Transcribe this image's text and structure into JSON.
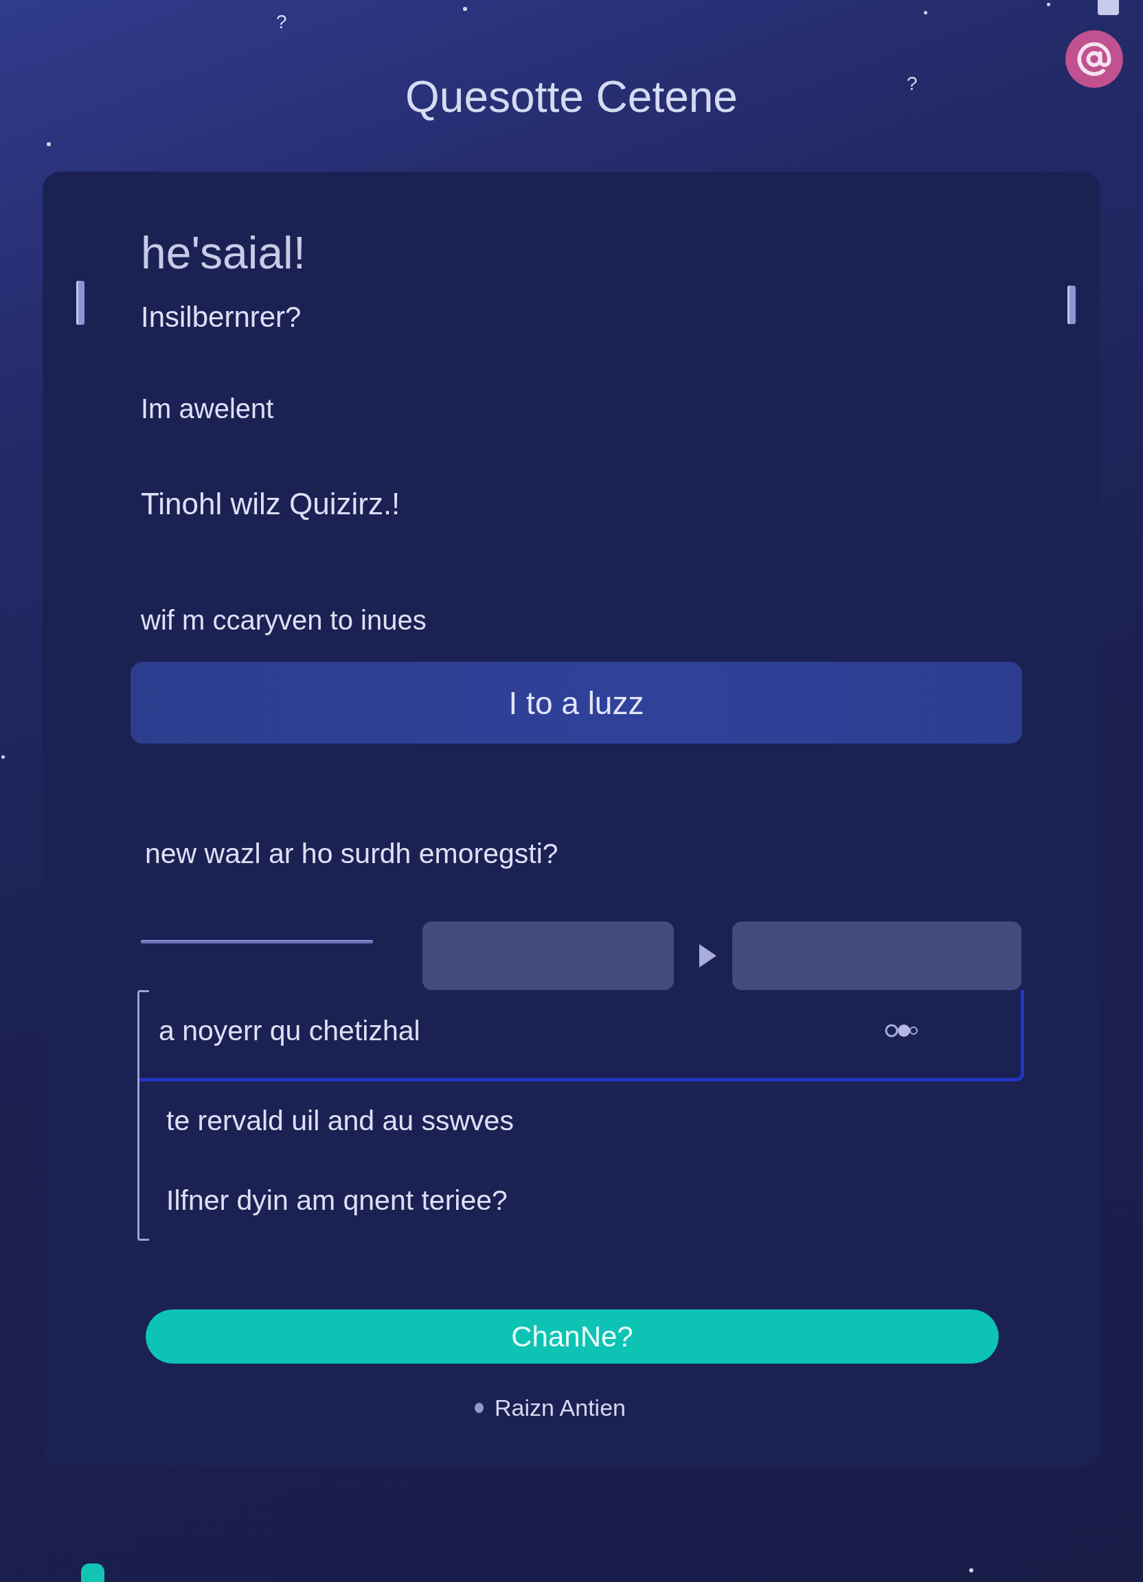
{
  "header": {
    "title": "Quesotte Cetene",
    "decor_marks": [
      "?",
      "?"
    ]
  },
  "card": {
    "heading": "he'saial!",
    "lines": [
      "Insilbernrer?",
      "Im awelent",
      "Tinohl wilz Quizirz.!",
      "wif m ccaryven to inues"
    ],
    "primary_button": "I to a luzz",
    "question": "new wazl ar ho surdh emoregsti?",
    "options": [
      {
        "label": "a noyerr qu chetizhal",
        "selected": true
      },
      {
        "label": "te rervald uil and au sswves",
        "selected": false
      },
      {
        "label": "Ilfner dyin am qnent teriee?",
        "selected": false
      }
    ],
    "submit_button": "ChanNe?",
    "footer_link": "Raizn Antien"
  }
}
